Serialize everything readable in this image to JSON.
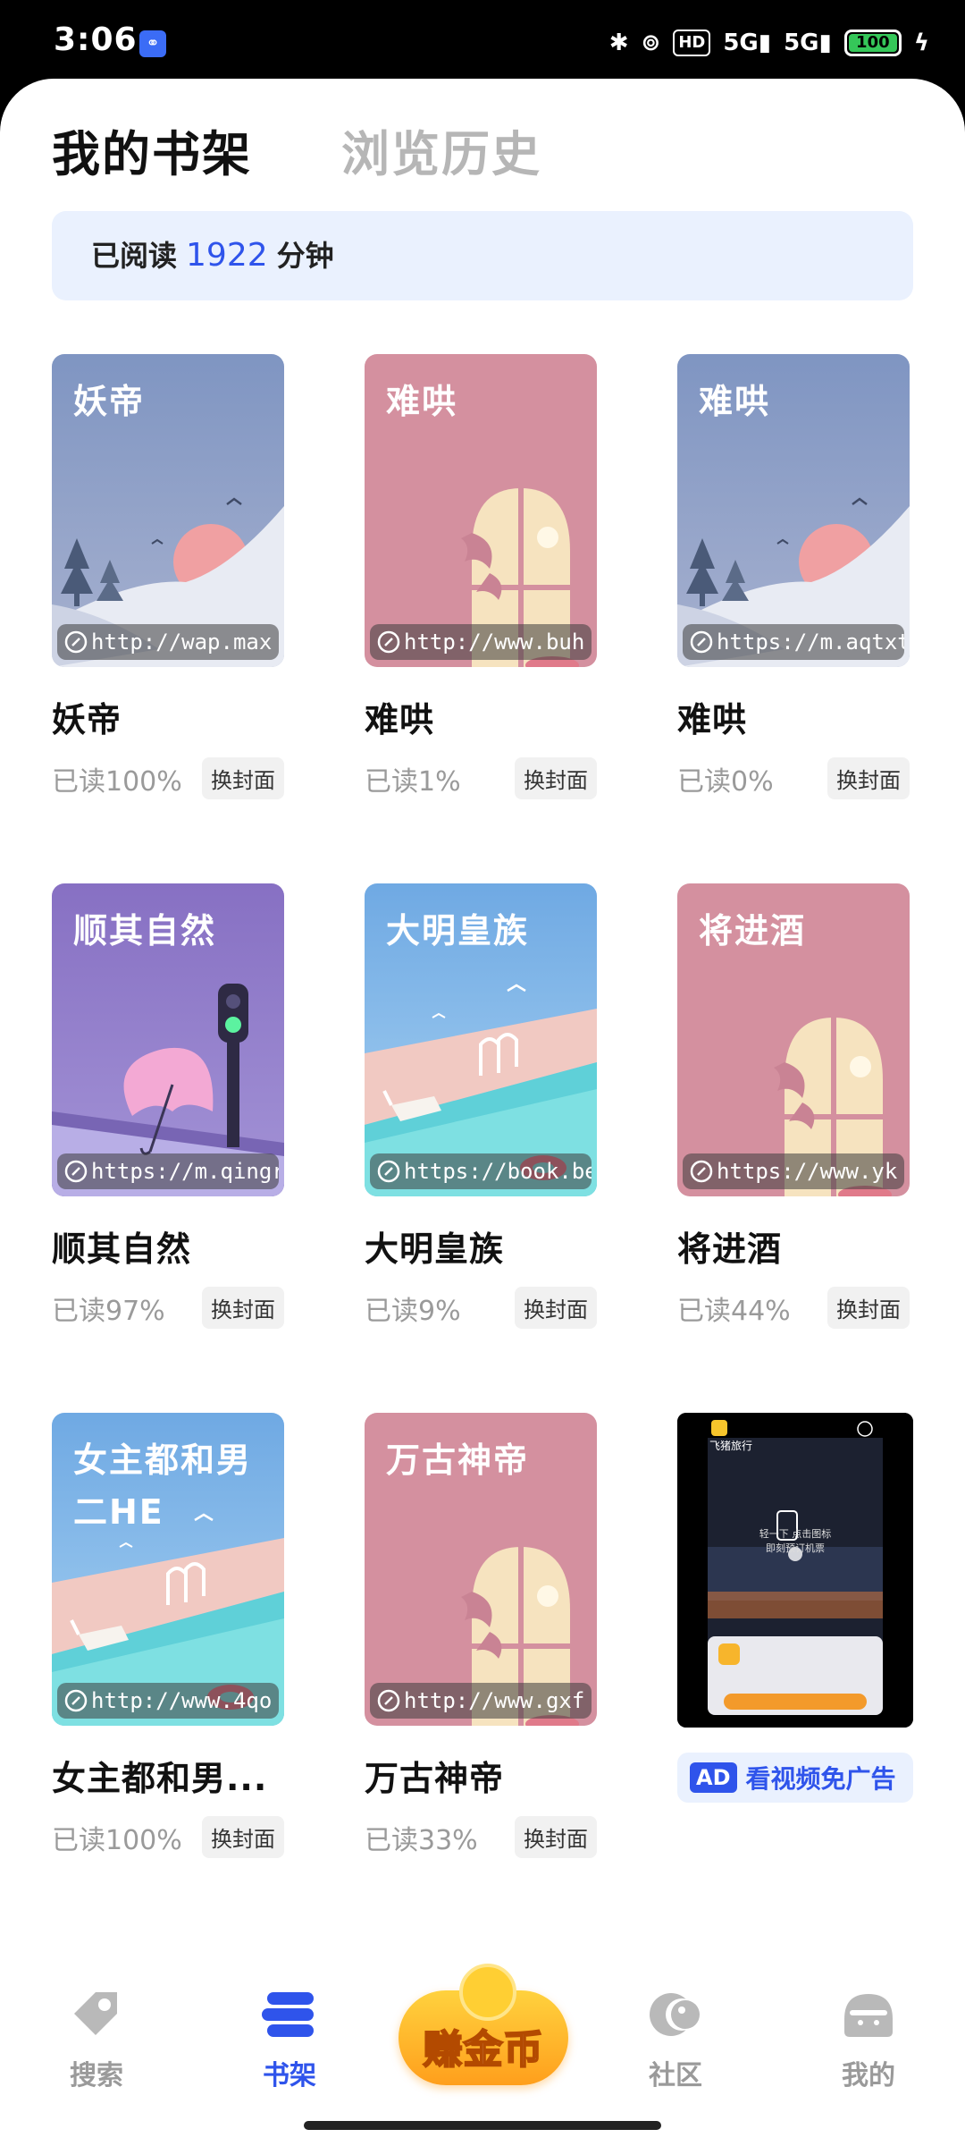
{
  "status_bar": {
    "time": "3:06",
    "hd": "HD",
    "net1": "5G",
    "net2": "5G",
    "battery": "100"
  },
  "tabs": [
    {
      "label": "我的书架",
      "active": true
    },
    {
      "label": "浏览历史",
      "active": false
    }
  ],
  "reading": {
    "prefix": "已阅读",
    "minutes": "1922",
    "suffix": "分钟"
  },
  "books": [
    {
      "title": "妖帝",
      "cover_title": "妖帝",
      "url": "http://wap.max",
      "progress": "已读100%",
      "change_cover": "换封面",
      "theme": "mountain"
    },
    {
      "title": "难哄",
      "cover_title": "难哄",
      "url": "http://www.buh",
      "progress": "已读1%",
      "change_cover": "换封面",
      "theme": "window"
    },
    {
      "title": "难哄",
      "cover_title": "难哄",
      "url": "https://m.aqtxt.",
      "progress": "已读0%",
      "change_cover": "换封面",
      "theme": "mountain"
    },
    {
      "title": "顺其自然",
      "cover_title": "顺其自然",
      "url": "https://m.qingr",
      "progress": "已读97%",
      "change_cover": "换封面",
      "theme": "umbrella"
    },
    {
      "title": "大明皇族",
      "cover_title": "大明皇族",
      "url": "https://book.be",
      "progress": "已读9%",
      "change_cover": "换封面",
      "theme": "pool"
    },
    {
      "title": "将进酒",
      "cover_title": "将进酒",
      "url": "https://www.yk",
      "progress": "已读44%",
      "change_cover": "换封面",
      "theme": "window"
    },
    {
      "title": "女主都和男...",
      "cover_title": "女主都和男二HE",
      "url": "http://www.4qo",
      "progress": "已读100%",
      "change_cover": "换封面",
      "theme": "pool"
    },
    {
      "title": "万古神帝",
      "cover_title": "万古神帝",
      "url": "http://www.gxf",
      "progress": "已读33%",
      "change_cover": "换封面",
      "theme": "window"
    }
  ],
  "ad": {
    "tag": "AD",
    "label": "看视频免广告",
    "brand": "飞猪旅行",
    "video_text1": "轻一下 点击图标",
    "video_text2": "即刻预订机票"
  },
  "nav": [
    {
      "label": "搜索",
      "icon": "search-tag-icon",
      "active": false
    },
    {
      "label": "书架",
      "icon": "bookshelf-icon",
      "active": true
    },
    {
      "label": "赚金币",
      "icon": "coin-book-icon",
      "active": false
    },
    {
      "label": "社区",
      "icon": "community-icon",
      "active": false
    },
    {
      "label": "我的",
      "icon": "profile-icon",
      "active": false
    }
  ],
  "colors": {
    "accent": "#2f54eb",
    "mountain_bg": "#8a9dc4",
    "window_bg": "#d4909f",
    "umbrella_bg": "#8e79c8",
    "pool_bg": "#78b2e6"
  }
}
